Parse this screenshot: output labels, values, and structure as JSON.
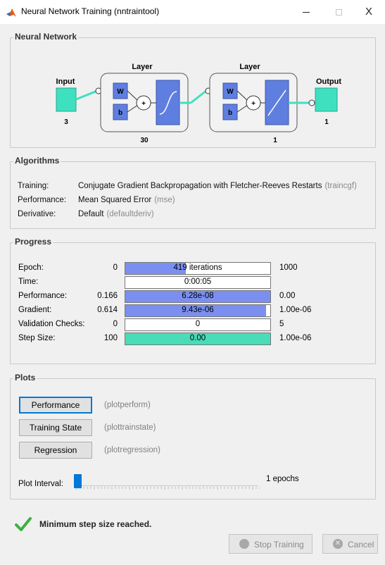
{
  "window": {
    "title": "Neural Network Training (nntraintool)",
    "minimize_label": "–",
    "maximize_label": "☐",
    "close_label": "X"
  },
  "network": {
    "section_title": "Neural Network",
    "input_label": "Input",
    "input_size": "3",
    "output_label": "Output",
    "output_size": "1",
    "layers": [
      {
        "title": "Layer",
        "w_label": "W",
        "b_label": "b",
        "sum_label": "+",
        "size": "30"
      },
      {
        "title": "Layer",
        "w_label": "W",
        "b_label": "b",
        "sum_label": "+",
        "size": "1"
      }
    ]
  },
  "algorithms": {
    "section_title": "Algorithms",
    "rows": [
      {
        "key": "Training:",
        "value": "Conjugate Gradient Backpropagation with Fletcher-Reeves Restarts",
        "fn": "(traincgf)"
      },
      {
        "key": "Performance:",
        "value": "Mean Squared Error",
        "fn": "(mse)"
      },
      {
        "key": "Derivative:",
        "value": "Default",
        "fn": "(defaultderiv)"
      }
    ]
  },
  "progress": {
    "section_title": "Progress",
    "rows": [
      {
        "label": "Epoch:",
        "min": "0",
        "bar_text": "419 iterations",
        "max": "1000",
        "fill_fraction": 0.419,
        "fill_color": "#7b8ff0"
      },
      {
        "label": "Time:",
        "min": "",
        "bar_text": "0:00:05",
        "max": "",
        "fill_fraction": 0,
        "fill_color": "#7b8ff0"
      },
      {
        "label": "Performance:",
        "min": "0.166",
        "bar_text": "6.28e-08",
        "max": "0.00",
        "fill_fraction": 1.0,
        "fill_color": "#7b8ff0"
      },
      {
        "label": "Gradient:",
        "min": "0.614",
        "bar_text": "9.43e-06",
        "max": "1.00e-06",
        "fill_fraction": 0.97,
        "fill_color": "#7b8ff0"
      },
      {
        "label": "Validation Checks:",
        "min": "0",
        "bar_text": "0",
        "max": "5",
        "fill_fraction": 0,
        "fill_color": "#7b8ff0"
      },
      {
        "label": "Step Size:",
        "min": "100",
        "bar_text": "0.00",
        "max": "1.00e-06",
        "fill_fraction": 1.0,
        "fill_color": "#48dcb8"
      }
    ]
  },
  "plots": {
    "section_title": "Plots",
    "buttons": [
      {
        "label": "Performance",
        "fn": "(plotperform)"
      },
      {
        "label": "Training State",
        "fn": "(plottrainstate)"
      },
      {
        "label": "Regression",
        "fn": "(plotregression)"
      }
    ],
    "interval_label": "Plot Interval:",
    "interval_value": "1 epochs",
    "interval_fraction": 0.0
  },
  "status": {
    "message": "Minimum step size reached.",
    "icon": "checkmark-icon",
    "icon_color": "#3cb043"
  },
  "footer": {
    "stop_label": "Stop Training",
    "cancel_label": "Cancel",
    "cancel_icon_glyph": "✕"
  },
  "colors": {
    "block_teal": "#3fe0c0",
    "block_blue": "#5f7fe0",
    "progress_blue": "#7b8ff0",
    "accent": "#0078d7"
  }
}
